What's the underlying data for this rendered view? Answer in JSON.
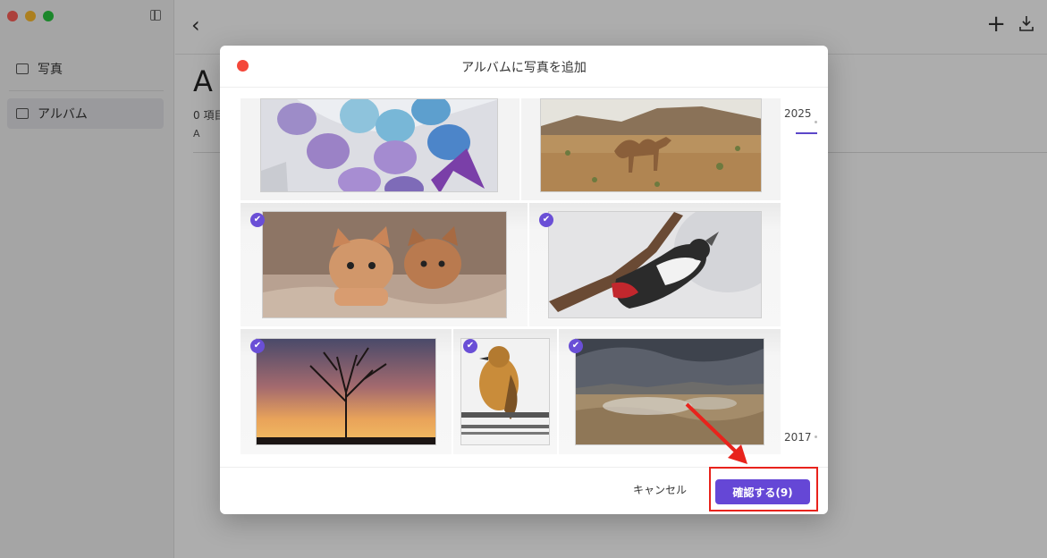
{
  "sidebar": {
    "items": [
      {
        "label": "写真",
        "icon": "photo-icon"
      },
      {
        "label": "アルバム",
        "icon": "album-icon"
      }
    ]
  },
  "album": {
    "title": "A",
    "count": "0 項目",
    "sub": "A"
  },
  "dialog": {
    "title": "アルバムに写真を追加",
    "cancel_label": "キャンセル",
    "confirm_label": "確認する(9)",
    "timeline": [
      "2025",
      "2017"
    ]
  },
  "photos": [
    {
      "name": "easter-eggs",
      "selected": true
    },
    {
      "name": "camel-desert",
      "selected": true
    },
    {
      "name": "kittens",
      "selected": true
    },
    {
      "name": "woodpecker",
      "selected": true
    },
    {
      "name": "sunset-tree",
      "selected": true
    },
    {
      "name": "bird-on-wire",
      "selected": true
    },
    {
      "name": "geothermal-landscape",
      "selected": true
    }
  ],
  "colors": {
    "accent": "#6547d6",
    "close": "#f4473a",
    "highlight": "#e8231c"
  }
}
